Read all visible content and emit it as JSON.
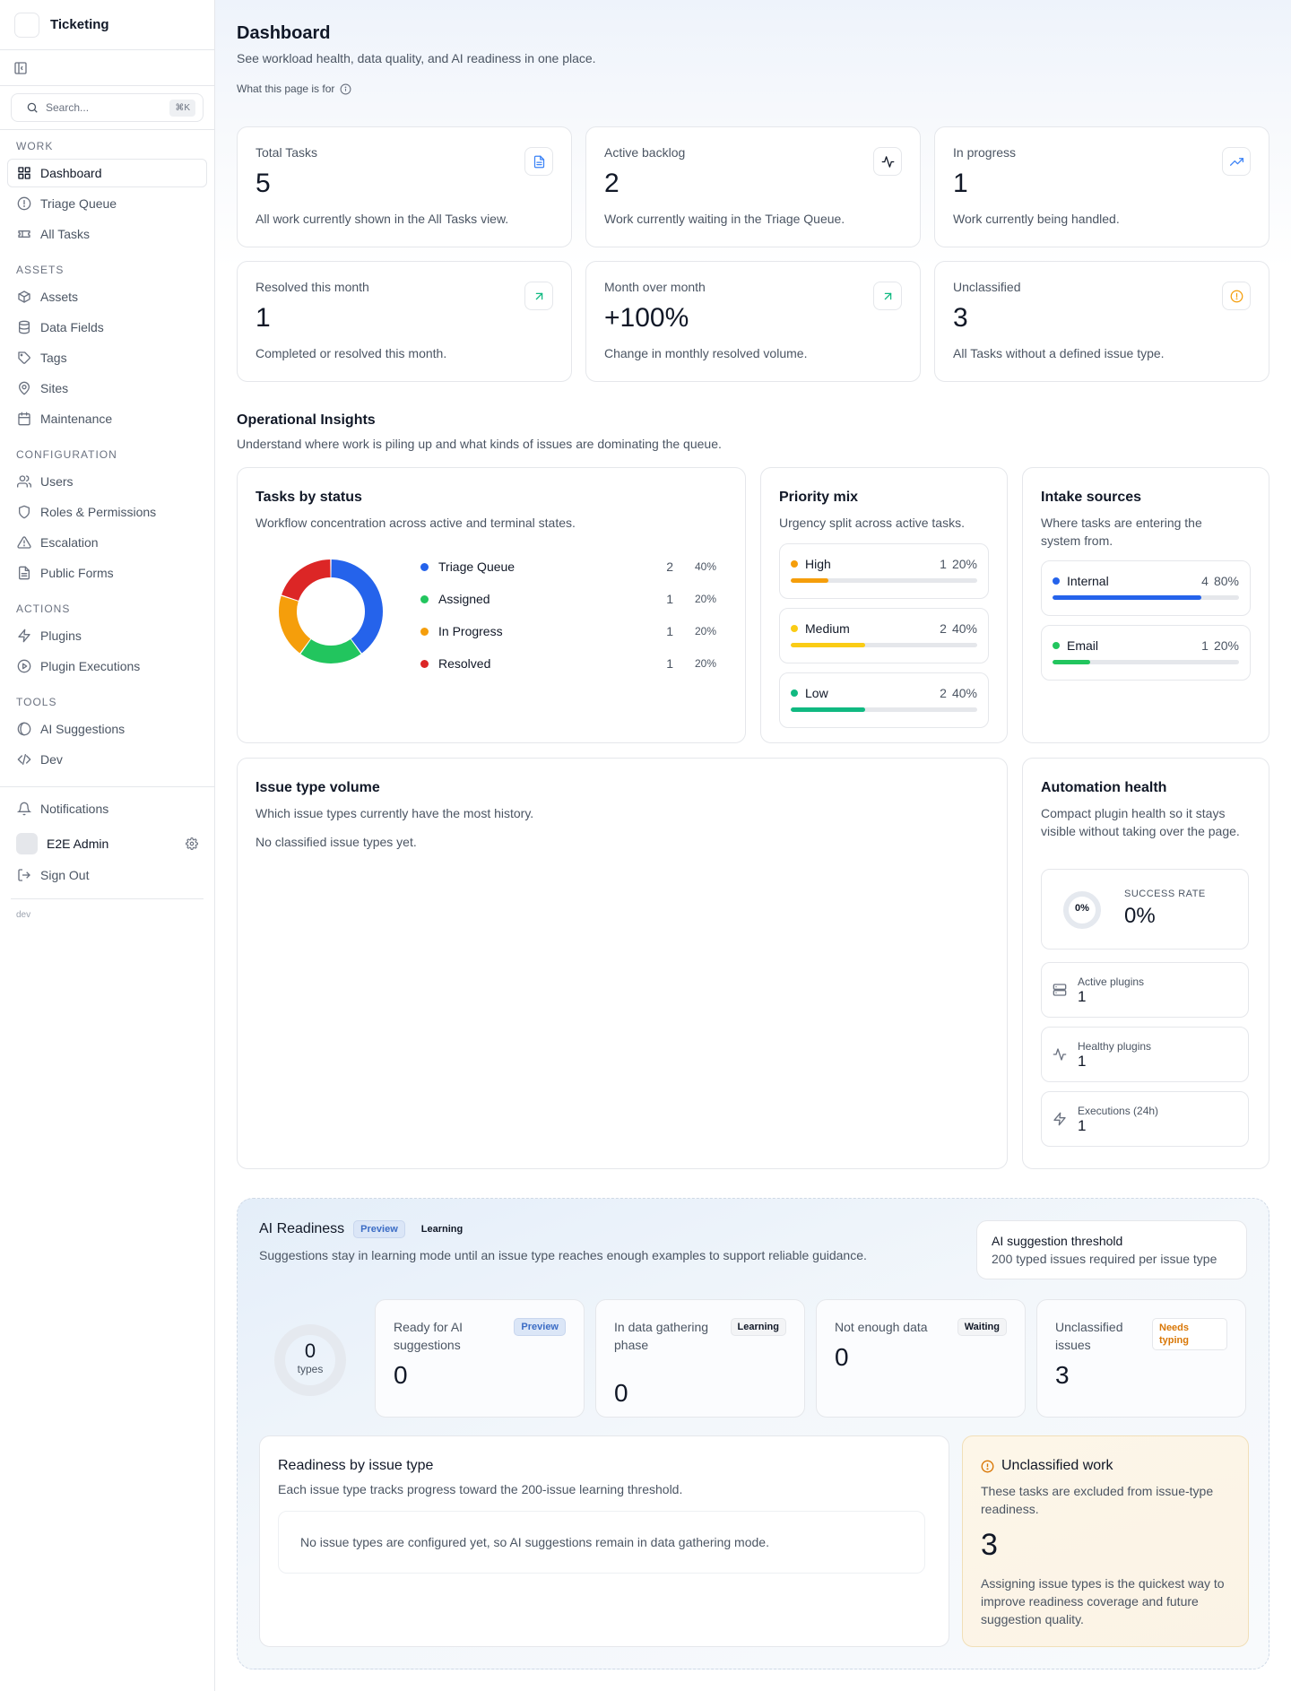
{
  "app": {
    "name": "Ticketing"
  },
  "search": {
    "placeholder": "Search...",
    "shortcut": "⌘K"
  },
  "sidebar": {
    "sections": [
      {
        "label": "WORK",
        "items": [
          {
            "label": "Dashboard",
            "icon": "grid-icon"
          },
          {
            "label": "Triage Queue",
            "icon": "alert-circle-icon"
          },
          {
            "label": "All Tasks",
            "icon": "ticket-icon"
          }
        ]
      },
      {
        "label": "ASSETS",
        "items": [
          {
            "label": "Assets",
            "icon": "box-icon"
          },
          {
            "label": "Data Fields",
            "icon": "database-icon"
          },
          {
            "label": "Tags",
            "icon": "tag-icon"
          },
          {
            "label": "Sites",
            "icon": "map-pin-icon"
          },
          {
            "label": "Maintenance",
            "icon": "calendar-icon"
          }
        ]
      },
      {
        "label": "CONFIGURATION",
        "items": [
          {
            "label": "Users",
            "icon": "users-icon"
          },
          {
            "label": "Roles & Permissions",
            "icon": "shield-icon"
          },
          {
            "label": "Escalation",
            "icon": "warning-icon"
          },
          {
            "label": "Public Forms",
            "icon": "file-icon"
          }
        ]
      },
      {
        "label": "ACTIONS",
        "items": [
          {
            "label": "Plugins",
            "icon": "bolt-icon"
          },
          {
            "label": "Plugin Executions",
            "icon": "play-circle-icon"
          }
        ]
      },
      {
        "label": "TOOLS",
        "items": [
          {
            "label": "AI Suggestions",
            "icon": "ai-icon"
          },
          {
            "label": "Dev",
            "icon": "code-icon"
          }
        ]
      }
    ],
    "notifications": "Notifications",
    "user": "E2E Admin",
    "sign_out": "Sign Out",
    "env": "dev"
  },
  "header": {
    "title": "Dashboard",
    "subtitle": "See workload health, data quality, and AI readiness in one place.",
    "help": "What this page is for"
  },
  "stats": [
    {
      "label": "Total Tasks",
      "value": "5",
      "desc": "All work currently shown in the All Tasks view.",
      "icon": "document-icon",
      "color": "#3b82f6"
    },
    {
      "label": "Active backlog",
      "value": "2",
      "desc": "Work currently waiting in the Triage Queue.",
      "icon": "activity-icon",
      "color": "#111827"
    },
    {
      "label": "In progress",
      "value": "1",
      "desc": "Work currently being handled.",
      "icon": "trending-up-icon",
      "color": "#3b82f6"
    },
    {
      "label": "Resolved this month",
      "value": "1",
      "desc": "Completed or resolved this month.",
      "icon": "arrow-up-right-icon",
      "color": "#10b981"
    },
    {
      "label": "Month over month",
      "value": "+100%",
      "desc": "Change in monthly resolved volume.",
      "icon": "arrow-up-right-icon",
      "color": "#10b981"
    },
    {
      "label": "Unclassified",
      "value": "3",
      "desc": "All Tasks without a defined issue type.",
      "icon": "alert-circle-icon",
      "color": "#f59e0b"
    }
  ],
  "insights": {
    "title": "Operational Insights",
    "subtitle": "Understand where work is piling up and what kinds of issues are dominating the queue."
  },
  "status_chart": {
    "title": "Tasks by status",
    "subtitle": "Workflow concentration across active and terminal states.",
    "items": [
      {
        "label": "Triage Queue",
        "count": "2",
        "pct": "40%",
        "value": 2,
        "color": "#2563eb"
      },
      {
        "label": "Assigned",
        "count": "1",
        "pct": "20%",
        "value": 1,
        "color": "#22c55e"
      },
      {
        "label": "In Progress",
        "count": "1",
        "pct": "20%",
        "value": 1,
        "color": "#f59e0b"
      },
      {
        "label": "Resolved",
        "count": "1",
        "pct": "20%",
        "value": 1,
        "color": "#dc2626"
      }
    ]
  },
  "priority": {
    "title": "Priority mix",
    "subtitle": "Urgency split across active tasks.",
    "items": [
      {
        "label": "High",
        "count": "1",
        "pct": "20%",
        "fraction": 0.2,
        "color": "#f59e0b"
      },
      {
        "label": "Medium",
        "count": "2",
        "pct": "40%",
        "fraction": 0.4,
        "color": "#facc15"
      },
      {
        "label": "Low",
        "count": "2",
        "pct": "40%",
        "fraction": 0.4,
        "color": "#10b981"
      }
    ]
  },
  "intake": {
    "title": "Intake sources",
    "subtitle": "Where tasks are entering the system from.",
    "items": [
      {
        "label": "Internal",
        "count": "4",
        "pct": "80%",
        "fraction": 0.8,
        "color": "#2563eb"
      },
      {
        "label": "Email",
        "count": "1",
        "pct": "20%",
        "fraction": 0.2,
        "color": "#22c55e"
      }
    ]
  },
  "issue_volume": {
    "title": "Issue type volume",
    "subtitle": "Which issue types currently have the most history.",
    "empty": "No classified issue types yet."
  },
  "automation": {
    "title": "Automation health",
    "subtitle": "Compact plugin health so it stays visible without taking over the page.",
    "success_label": "SUCCESS RATE",
    "success_value": "0%",
    "ring_label": "0%",
    "success_fraction": 0,
    "metrics": [
      {
        "label": "Active plugins",
        "value": "1",
        "icon": "server-icon"
      },
      {
        "label": "Healthy plugins",
        "value": "1",
        "icon": "activity-icon"
      },
      {
        "label": "Executions (24h)",
        "value": "1",
        "icon": "bolt-icon"
      }
    ]
  },
  "ai": {
    "title": "AI Readiness",
    "badge_preview": "Preview",
    "badge_learning": "Learning",
    "subtitle": "Suggestions stay in learning mode until an issue type reaches enough examples to support reliable guidance.",
    "threshold_title": "AI suggestion threshold",
    "threshold_desc": "200 typed issues required per issue type",
    "ring_value": "0",
    "ring_label": "types",
    "cards": [
      {
        "label": "Ready for AI suggestions",
        "value": "0",
        "badge": "Preview"
      },
      {
        "label": "In data gathering phase",
        "value": "0",
        "badge": "Learning"
      },
      {
        "label": "Not enough data",
        "value": "0",
        "badge": "Waiting"
      },
      {
        "label": "Unclassified issues",
        "value": "3",
        "badge": "Needs typing"
      }
    ],
    "readiness_title": "Readiness by issue type",
    "readiness_sub": "Each issue type tracks progress toward the 200-issue learning threshold.",
    "readiness_empty": "No issue types are configured yet, so AI suggestions remain in data gathering mode.",
    "unclassified_title": "Unclassified work",
    "unclassified_sub": "These tasks are excluded from issue-type readiness.",
    "unclassified_value": "3",
    "unclassified_note": "Assigning issue types is the quickest way to improve readiness coverage and future suggestion quality."
  }
}
